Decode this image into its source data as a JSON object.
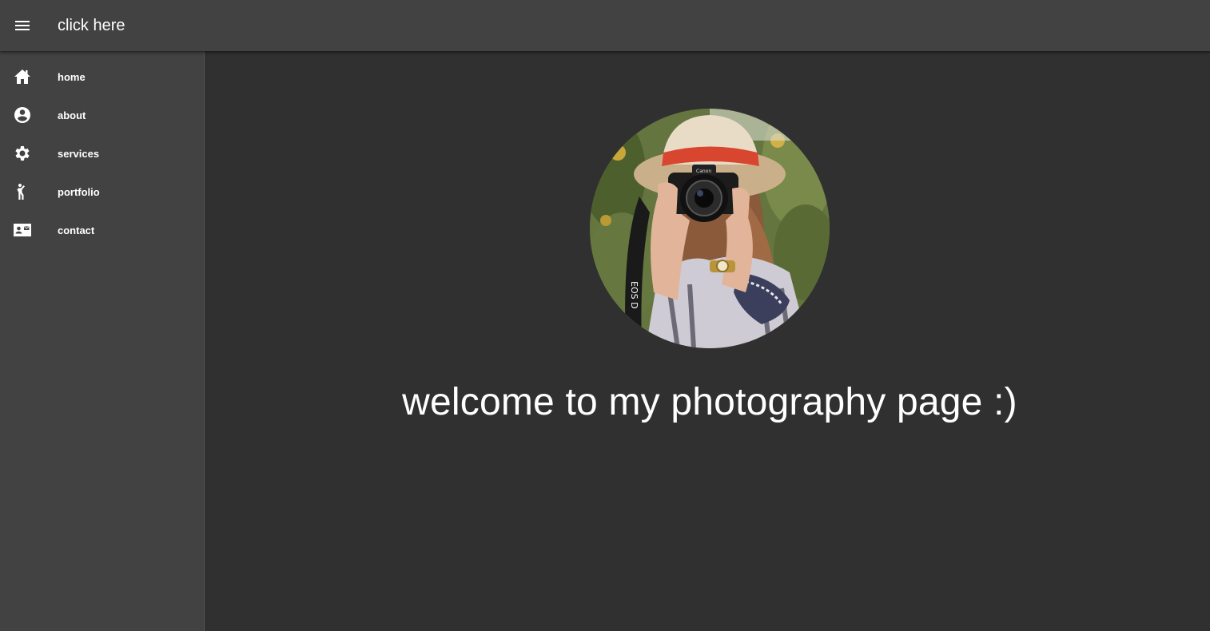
{
  "appbar": {
    "menu_icon": "hamburger-menu-icon",
    "title": "click here"
  },
  "sidebar": {
    "items": [
      {
        "icon": "home-icon",
        "label": "home"
      },
      {
        "icon": "account-circle-icon",
        "label": "about"
      },
      {
        "icon": "gear-icon",
        "label": "services"
      },
      {
        "icon": "person-pose-icon",
        "label": "portfolio"
      },
      {
        "icon": "contact-card-icon",
        "label": "contact"
      }
    ]
  },
  "main": {
    "avatar_image": "photographer-with-camera-photo",
    "welcome": "welcome to my photography page :)"
  },
  "colors": {
    "appbar": "#424242",
    "sidebar": "#424242",
    "background": "#303030",
    "text": "#ffffff"
  }
}
